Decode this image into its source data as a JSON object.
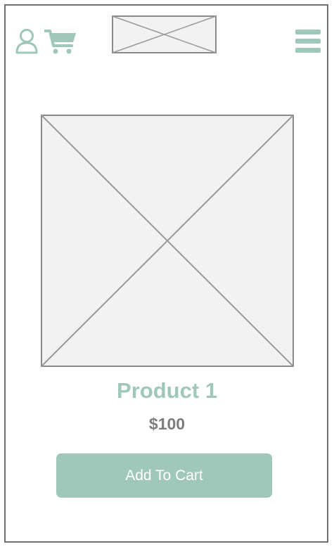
{
  "colors": {
    "accent": "#9fc7bc",
    "price": "#7d7d7d",
    "placeholder_fill": "#f2f2f2",
    "placeholder_stroke": "#9a9a9a",
    "frame": "#6f6f6f"
  },
  "header": {
    "user_icon": "user-icon",
    "cart_icon": "cart-icon",
    "logo": "logo-image-placeholder",
    "menu_icon": "hamburger-menu-icon"
  },
  "product": {
    "image": "image-placeholder",
    "name": "Product 1",
    "price": "$100",
    "add_to_cart_label": "Add To Cart"
  }
}
